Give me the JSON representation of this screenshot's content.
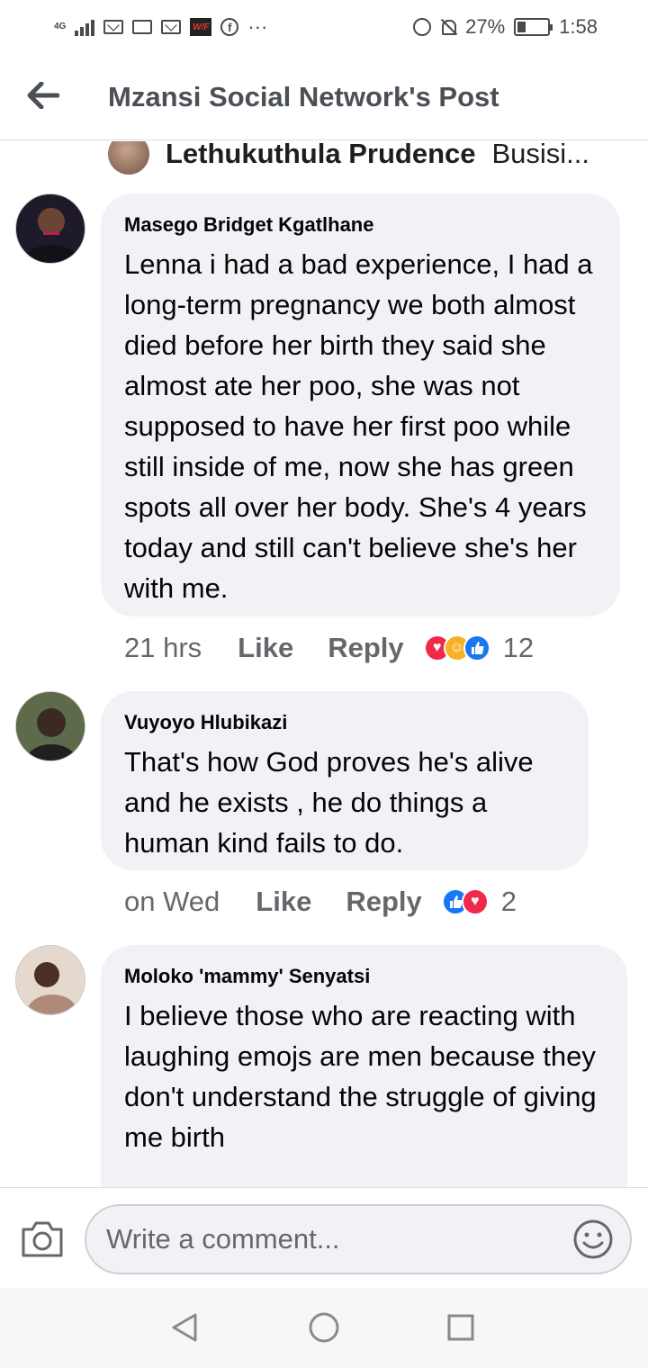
{
  "status_bar": {
    "network": "4G",
    "battery_percent": "27%",
    "battery_level": 0.27,
    "time": "1:58",
    "more": "···"
  },
  "header": {
    "title": "Mzansi Social Network's Post"
  },
  "partial_comment": {
    "name": "Lethukuthula Prudence",
    "text": "Busisi..."
  },
  "comments": [
    {
      "author": "Masego Bridget Kgatlhane",
      "text": "Lenna i had a bad experience, I had a long-term pregnancy we both almost died before her birth they said she almost ate her poo, she was not supposed to have her first poo while still inside of me, now she has green spots all over her body. She's 4 years today and still can't believe she's her with me.",
      "time": "21 hrs",
      "like_label": "Like",
      "reply_label": "Reply",
      "reactions": [
        "heart-icon",
        "care-icon",
        "like-icon"
      ],
      "reaction_count": "12"
    },
    {
      "author": "Vuyoyo Hlubikazi",
      "text": "That's how God proves he's alive and he exists , he do things a human kind fails to do.",
      "time": "on Wed",
      "like_label": "Like",
      "reply_label": "Reply",
      "reactions": [
        "like-icon",
        "heart-icon"
      ],
      "reaction_count": "2"
    },
    {
      "author": "Moloko 'mammy' Senyatsi",
      "text": "I believe those who are reacting with laughing emojs are men because they don't understand the struggle of giving me birth"
    }
  ],
  "composer": {
    "placeholder": "Write a comment..."
  },
  "colors": {
    "bubble": "#f0f2f5",
    "like_blue": "#1877f2",
    "heart_red": "#f02849",
    "care_yellow": "#f7b125"
  }
}
